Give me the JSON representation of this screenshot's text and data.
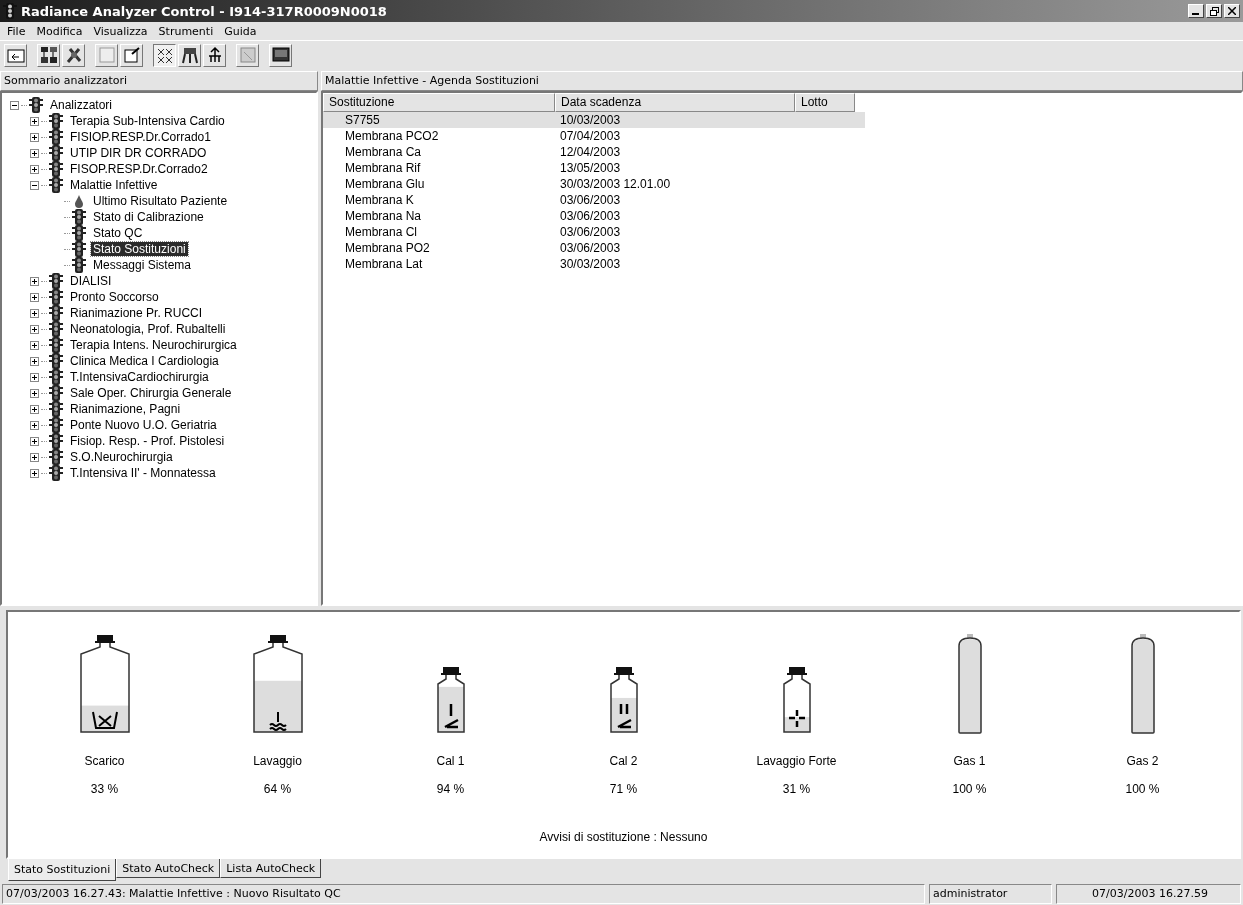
{
  "window": {
    "title": "Radiance Analyzer Control - I914-317R0009N0018"
  },
  "menu": [
    "File",
    "Modifica",
    "Visualizza",
    "Strumenti",
    "Guida"
  ],
  "tree": {
    "title": "Sommario analizzatori",
    "items": [
      {
        "label": "Analizzatori",
        "kind": "light",
        "expanded": true,
        "selected": false,
        "children": [
          {
            "label": "Terapia Sub-Intensiva Cardio",
            "kind": "light",
            "expanded": false,
            "selected": false
          },
          {
            "label": "FISIOP.RESP.Dr.Corrado1",
            "kind": "light",
            "expanded": false,
            "selected": false
          },
          {
            "label": "UTIP   DIR DR CORRADO",
            "kind": "light",
            "expanded": false,
            "selected": false
          },
          {
            "label": "FISOP.RESP.Dr.Corrado2",
            "kind": "light",
            "expanded": false,
            "selected": false
          },
          {
            "label": "Malattie Infettive",
            "kind": "light",
            "expanded": true,
            "selected": false,
            "children": [
              {
                "label": "Ultimo Risultato Paziente",
                "kind": "drop",
                "selected": false
              },
              {
                "label": "Stato di Calibrazione",
                "kind": "light",
                "selected": false
              },
              {
                "label": "Stato QC",
                "kind": "light",
                "selected": false
              },
              {
                "label": "Stato Sostituzioni",
                "kind": "light",
                "selected": true
              },
              {
                "label": "Messaggi Sistema",
                "kind": "light",
                "selected": false
              }
            ]
          },
          {
            "label": "DIALISI",
            "kind": "light",
            "expanded": false,
            "selected": false
          },
          {
            "label": "Pronto Soccorso",
            "kind": "light",
            "expanded": false,
            "selected": false
          },
          {
            "label": "Rianimazione Pr. RUCCI",
            "kind": "light",
            "expanded": false,
            "selected": false
          },
          {
            "label": "Neonatologia, Prof. Rubaltelli",
            "kind": "light",
            "expanded": false,
            "selected": false
          },
          {
            "label": "Terapia Intens. Neurochirurgica",
            "kind": "light",
            "expanded": false,
            "selected": false
          },
          {
            "label": "Clinica Medica I Cardiologia",
            "kind": "light",
            "expanded": false,
            "selected": false
          },
          {
            "label": "T.IntensivaCardiochirurgia",
            "kind": "light",
            "expanded": false,
            "selected": false
          },
          {
            "label": "Sale Oper. Chirurgia Generale",
            "kind": "light",
            "expanded": false,
            "selected": false
          },
          {
            "label": "Rianimazione, Pagni",
            "kind": "light",
            "expanded": false,
            "selected": false
          },
          {
            "label": "Ponte Nuovo U.O. Geriatria",
            "kind": "light",
            "expanded": false,
            "selected": false
          },
          {
            "label": "Fisiop. Resp. - Prof. Pistolesi",
            "kind": "light",
            "expanded": false,
            "selected": false
          },
          {
            "label": "S.O.Neurochirurgia",
            "kind": "light",
            "expanded": false,
            "selected": false
          },
          {
            "label": "T.Intensiva II' - Monnatessa",
            "kind": "light",
            "expanded": false,
            "selected": false
          }
        ]
      }
    ]
  },
  "agenda": {
    "title": "Malattie Infettive - Agenda Sostituzioni",
    "columns": [
      "Sostituzione",
      "Data scadenza",
      "Lotto"
    ],
    "rows": [
      {
        "cells": [
          "S7755",
          "10/03/2003"
        ],
        "selected": true
      },
      {
        "cells": [
          "Membrana PCO2",
          "07/04/2003"
        ],
        "selected": false
      },
      {
        "cells": [
          "Membrana Ca",
          "12/04/2003"
        ],
        "selected": false
      },
      {
        "cells": [
          "Membrana Rif",
          "13/05/2003"
        ],
        "selected": false
      },
      {
        "cells": [
          "Membrana Glu",
          "30/03/2003 12.01.00"
        ],
        "selected": false
      },
      {
        "cells": [
          "Membrana K",
          "03/06/2003"
        ],
        "selected": false
      },
      {
        "cells": [
          "Membrana Na",
          "03/06/2003"
        ],
        "selected": false
      },
      {
        "cells": [
          "Membrana Cl",
          "03/06/2003"
        ],
        "selected": false
      },
      {
        "cells": [
          "Membrana PO2",
          "03/06/2003"
        ],
        "selected": false
      },
      {
        "cells": [
          "Membrana Lat",
          "30/03/2003"
        ],
        "selected": false
      }
    ]
  },
  "containers": [
    {
      "name": "Scarico",
      "reading": "33 %",
      "kind": "waste"
    },
    {
      "name": "Lavaggio",
      "reading": "64 %",
      "kind": "wash"
    },
    {
      "name": "Cal 1",
      "reading": "94 %",
      "kind": "cal1"
    },
    {
      "name": "Cal 2",
      "reading": "71 %",
      "kind": "cal2"
    },
    {
      "name": "Lavaggio Forte",
      "reading": "31 %",
      "kind": "strongwash"
    },
    {
      "name": "Gas 1",
      "reading": "100 %",
      "kind": "gas"
    },
    {
      "name": "Gas 2",
      "reading": "100 %",
      "kind": "gas"
    }
  ],
  "notice": "Avvisi di sostituzione  :  Nessuno",
  "tabs": [
    {
      "label": "Stato Sostituzioni",
      "selected": true
    },
    {
      "label": "Stato AutoCheck",
      "selected": false
    },
    {
      "label": "Lista AutoCheck",
      "selected": false
    }
  ],
  "status_bar": {
    "message": "07/03/2003 16.27.43: Malattie Infettive : Nuovo Risultato QC",
    "user": "administrator",
    "datetime": "07/03/2003 16.27.59"
  }
}
